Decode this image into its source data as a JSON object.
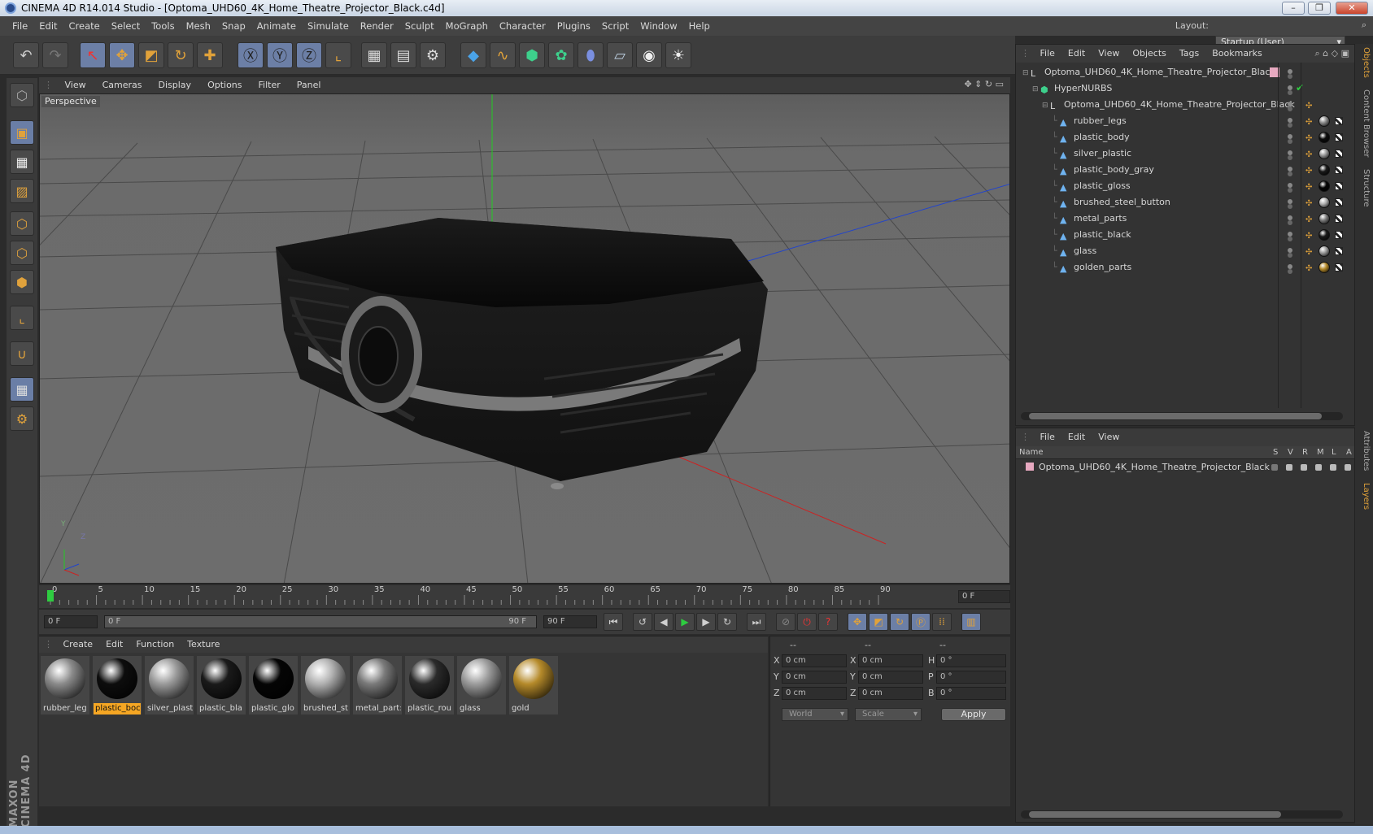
{
  "window": {
    "title": "CINEMA 4D R14.014 Studio - [Optoma_UHD60_4K_Home_Theatre_Projector_Black.c4d]",
    "buttons": [
      "–",
      "❐",
      "✕"
    ]
  },
  "menubar": {
    "items": [
      "File",
      "Edit",
      "Create",
      "Select",
      "Tools",
      "Mesh",
      "Snap",
      "Animate",
      "Simulate",
      "Render",
      "Sculpt",
      "MoGraph",
      "Character",
      "Plugins",
      "Script",
      "Window",
      "Help"
    ],
    "layout_label": "Layout:",
    "layout_value": "Startup (User)"
  },
  "viewport": {
    "menu": [
      "View",
      "Cameras",
      "Display",
      "Options",
      "Filter",
      "Panel"
    ],
    "label": "Perspective",
    "axis_y": "Y",
    "axis_z": "Z"
  },
  "timeline": {
    "ticks": [
      "0",
      "5",
      "10",
      "15",
      "20",
      "25",
      "30",
      "35",
      "40",
      "45",
      "50",
      "55",
      "60",
      "65",
      "70",
      "75",
      "80",
      "85",
      "90"
    ],
    "current_frame": "0 F"
  },
  "playbar": {
    "start_field": "0 F",
    "range_start": "0 F",
    "range_end": "90 F",
    "end_field": "90 F"
  },
  "materials": {
    "menu": [
      "Create",
      "Edit",
      "Function",
      "Texture"
    ],
    "items": [
      {
        "label": "rubber_leg",
        "color": "#8a8a8a"
      },
      {
        "label": "plastic_boc",
        "color": "#0d0d0d"
      },
      {
        "label": "silver_plast",
        "color": "#9a9a9a"
      },
      {
        "label": "plastic_bla",
        "color": "#1a1a1a"
      },
      {
        "label": "plastic_glo",
        "color": "#050505"
      },
      {
        "label": "brushed_st",
        "color": "#b0b0b0"
      },
      {
        "label": "metal_part:",
        "color": "#7a7a7a"
      },
      {
        "label": "plastic_rou",
        "color": "#2b2b2b"
      },
      {
        "label": "glass",
        "color": "#9c9c9c"
      },
      {
        "label": "gold",
        "color": "#b58a2a"
      }
    ],
    "selected_index": 1
  },
  "coordinates": {
    "headers": [
      "--",
      "--",
      "--"
    ],
    "rows": [
      {
        "l1": "X",
        "v1": "0 cm",
        "l2": "X",
        "v2": "0 cm",
        "l3": "H",
        "v3": "0 °"
      },
      {
        "l1": "Y",
        "v1": "0 cm",
        "l2": "Y",
        "v2": "0 cm",
        "l3": "P",
        "v3": "0 °"
      },
      {
        "l1": "Z",
        "v1": "0 cm",
        "l2": "Z",
        "v2": "0 cm",
        "l3": "B",
        "v3": "0 °"
      }
    ],
    "space": "World",
    "mode": "Scale",
    "apply": "Apply"
  },
  "objects": {
    "menu": [
      "File",
      "Edit",
      "View",
      "Objects",
      "Tags",
      "Bookmarks"
    ],
    "tree": [
      {
        "name": "Optoma_UHD60_4K_Home_Theatre_Projector_Black",
        "indent": 0,
        "kind": "null"
      },
      {
        "name": "HyperNURBS",
        "indent": 1,
        "kind": "nurbs"
      },
      {
        "name": "Optoma_UHD60_4K_Home_Theatre_Projector_Black",
        "indent": 2,
        "kind": "null"
      },
      {
        "name": "rubber_legs",
        "indent": 3,
        "kind": "poly",
        "mat": "#8a8a8a"
      },
      {
        "name": "plastic_body",
        "indent": 3,
        "kind": "poly",
        "mat": "#0d0d0d"
      },
      {
        "name": "silver_plastic",
        "indent": 3,
        "kind": "poly",
        "mat": "#9a9a9a"
      },
      {
        "name": "plastic_body_gray",
        "indent": 3,
        "kind": "poly",
        "mat": "#1a1a1a"
      },
      {
        "name": "plastic_gloss",
        "indent": 3,
        "kind": "poly",
        "mat": "#050505"
      },
      {
        "name": "brushed_steel_button",
        "indent": 3,
        "kind": "poly",
        "mat": "#b0b0b0"
      },
      {
        "name": "metal_parts",
        "indent": 3,
        "kind": "poly",
        "mat": "#7a7a7a"
      },
      {
        "name": "plastic_black",
        "indent": 3,
        "kind": "poly",
        "mat": "#1a1a1a"
      },
      {
        "name": "glass",
        "indent": 3,
        "kind": "poly",
        "mat": "#9c9c9c"
      },
      {
        "name": "golden_parts",
        "indent": 3,
        "kind": "poly",
        "mat": "#b58a2a"
      }
    ]
  },
  "layers": {
    "menu": [
      "File",
      "Edit",
      "View"
    ],
    "header_name": "Name",
    "header_cols": [
      "S",
      "V",
      "R",
      "M",
      "L",
      "A"
    ],
    "rows": [
      "Optoma_UHD60_4K_Home_Theatre_Projector_Black"
    ]
  },
  "sidetabs": [
    "Objects",
    "Content Browser",
    "Structure",
    "Attributes",
    "Layers"
  ],
  "brand": "MAXON CINEMA 4D",
  "colors": {
    "accent": "#f5a623",
    "selected_tool": "#6c7fa6",
    "axis_y": "#22cc22",
    "axis_x": "#cc2222",
    "axis_z": "#2244cc"
  }
}
